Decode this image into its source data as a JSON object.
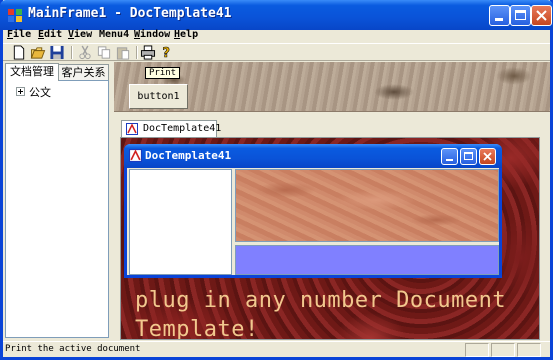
{
  "window": {
    "title": "MainFrame1 - DocTemplate41"
  },
  "menu": {
    "items": [
      {
        "label": "File",
        "accel": "F",
        "rest": "ile"
      },
      {
        "label": "Edit",
        "accel": "E",
        "rest": "dit"
      },
      {
        "label": "View",
        "accel": "V",
        "rest": "iew"
      },
      {
        "label": "Menu4",
        "accel": "",
        "rest": "Menu4"
      },
      {
        "label": "Window",
        "accel": "W",
        "rest": "indow"
      },
      {
        "label": "Help",
        "accel": "H",
        "rest": "elp"
      }
    ]
  },
  "toolbar": {
    "buttons": [
      "new-icon",
      "open-icon",
      "save-icon",
      "cut-icon",
      "copy-icon",
      "paste-icon",
      "print-icon",
      "help-icon"
    ]
  },
  "left_pane": {
    "tabs": [
      "文档管理",
      "客户关系"
    ],
    "tree": {
      "root_label": "公文"
    }
  },
  "banner": {
    "tooltip": "Print",
    "button_label": "button1"
  },
  "mdi": {
    "tab_label": "DocTemplate41",
    "background_text": "plug in any number Document Template!",
    "child_title": "DocTemplate41"
  },
  "colors": {
    "titlebar": "#0a53d8",
    "blue_panel": "#8080ff",
    "bg_text": "#f2c88e"
  },
  "status": {
    "text": "Print the active document"
  }
}
